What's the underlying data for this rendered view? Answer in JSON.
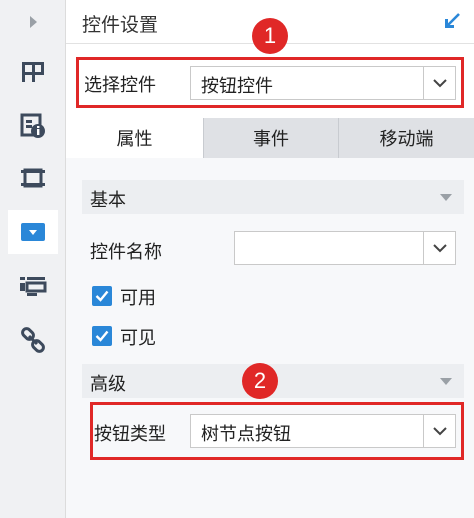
{
  "panel": {
    "title": "控件设置"
  },
  "rail": {
    "items": [
      {
        "icon": "expand-arrow-icon"
      },
      {
        "icon": "layout-icon"
      },
      {
        "icon": "widget-info-icon"
      },
      {
        "icon": "frame-icon"
      },
      {
        "icon": "widget-dropdown-icon",
        "active": true
      },
      {
        "icon": "list-widget-icon"
      },
      {
        "icon": "link-icon"
      }
    ]
  },
  "badges": {
    "first": "1",
    "second": "2"
  },
  "widget_select": {
    "label": "选择控件",
    "value": "按钮控件"
  },
  "tabs": [
    {
      "label": "属性",
      "active": true
    },
    {
      "label": "事件"
    },
    {
      "label": "移动端"
    }
  ],
  "basic": {
    "title": "基本",
    "name_label": "控件名称",
    "name_value": "",
    "enabled_label": "可用",
    "enabled": true,
    "visible_label": "可见",
    "visible": true
  },
  "advanced": {
    "title": "高级",
    "button_type_label": "按钮类型",
    "button_type_value": "树节点按钮"
  },
  "colors": {
    "accent": "#2a87d8",
    "highlight": "#e02827"
  }
}
